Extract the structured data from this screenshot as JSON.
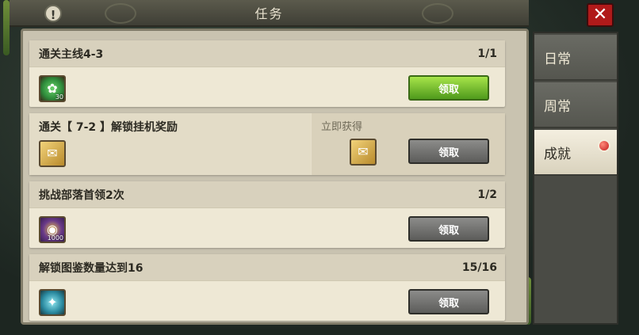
{
  "window": {
    "title": "任务",
    "info_glyph": "!",
    "close_glyph": "✕"
  },
  "tabs": [
    {
      "label": "日常",
      "active": false
    },
    {
      "label": "周常",
      "active": false
    },
    {
      "label": "成就",
      "active": true,
      "has_badge": true
    }
  ],
  "tasks": [
    {
      "name": "通关主线4-3",
      "progress": "1/1",
      "reward": {
        "icon": "green-crystal-icon",
        "qty": "30"
      },
      "button": {
        "label": "领取",
        "state": "enabled",
        "color": "#7cc52e"
      }
    },
    {
      "name": "通关【 7-2 】解锁挂机奖励",
      "progress": "",
      "instant_label": "立即获得",
      "reward": {
        "icon": "ticket-scroll-icon",
        "qty": ""
      },
      "instant_reward": {
        "icon": "ticket-scroll-icon"
      },
      "button": {
        "label": "领取",
        "state": "disabled",
        "color": "#6e6e6c"
      }
    },
    {
      "name": "挑战部落首领2次",
      "progress": "1/2",
      "reward": {
        "icon": "gold-coin-icon",
        "qty": "1000"
      },
      "button": {
        "label": "领取",
        "state": "disabled",
        "color": "#6e6e6c"
      }
    },
    {
      "name": "解锁图鉴数量达到16",
      "progress": "15/16",
      "reward": {
        "icon": "cyan-gem-icon",
        "qty": ""
      },
      "button": {
        "label": "领取",
        "state": "disabled",
        "color": "#6e6e6c"
      }
    }
  ]
}
